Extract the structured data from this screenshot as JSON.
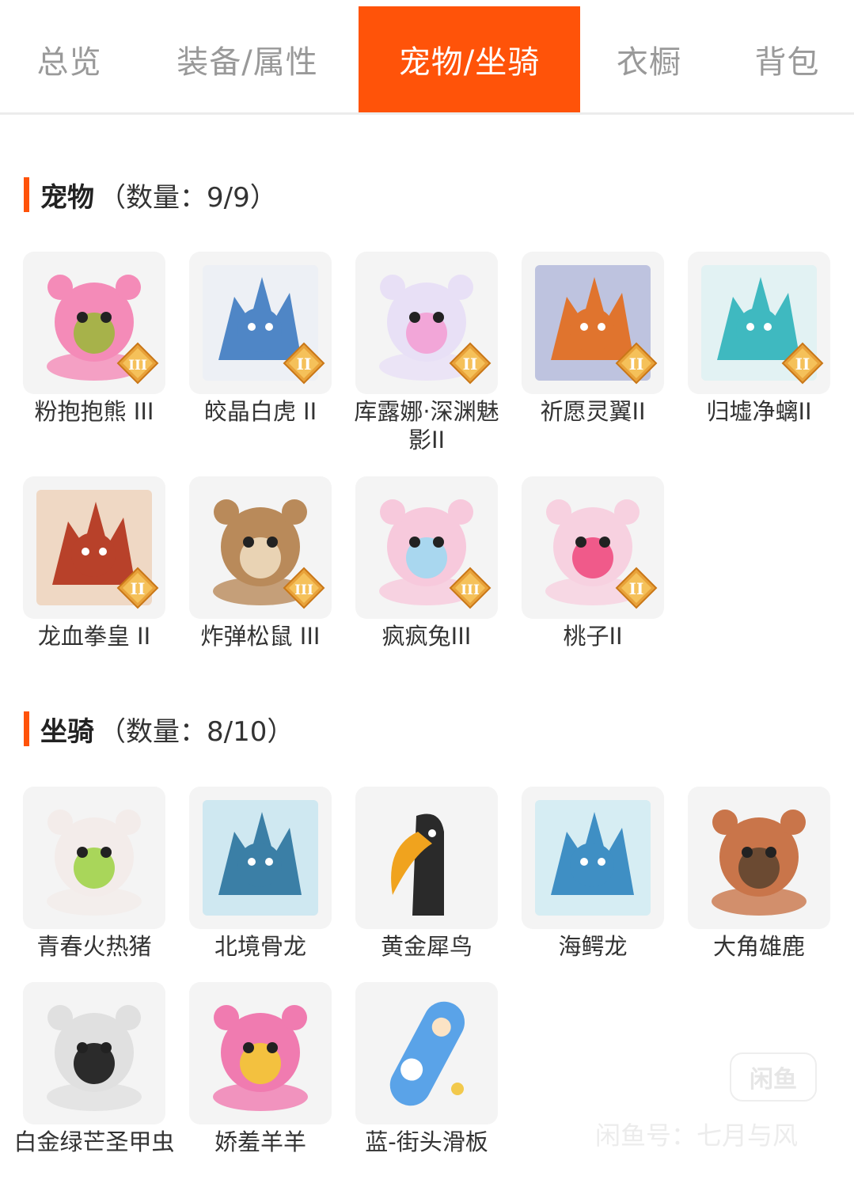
{
  "tabs": [
    "总览",
    "装备/属性",
    "宠物/坐骑",
    "衣橱",
    "背包"
  ],
  "active_tab": "宠物/坐骑",
  "colors": {
    "accent": "#ff5309",
    "tab_inactive": "#999999",
    "card_bg": "#f4f4f4"
  },
  "pets": {
    "title": "宠物",
    "count": "（数量：9/9）",
    "items": [
      {
        "label": "粉抱抱熊 III",
        "icon": "pink-bear-icon",
        "rank": "III"
      },
      {
        "label": "皎晶白虎 II",
        "icon": "white-tiger-icon",
        "rank": "II"
      },
      {
        "label": "库露娜·深渊魅影II",
        "icon": "abyss-fairy-icon",
        "rank": "II"
      },
      {
        "label": "祈愿灵翼II",
        "icon": "spirit-bird-icon",
        "rank": "II"
      },
      {
        "label": "归墟净螭II",
        "icon": "cyan-dragon-icon",
        "rank": "II"
      },
      {
        "label": "龙血拳皇 II",
        "icon": "red-ram-beast-icon",
        "rank": "II"
      },
      {
        "label": "炸弹松鼠 III",
        "icon": "squirrel-icon",
        "rank": "III"
      },
      {
        "label": "疯疯兔III",
        "icon": "bunny-icon",
        "rank": "III"
      },
      {
        "label": "桃子II",
        "icon": "pink-cat-icon",
        "rank": "II"
      }
    ]
  },
  "mounts": {
    "title": "坐骑",
    "count": "（数量：8/10）",
    "items": [
      {
        "label": "青春火热猪",
        "icon": "pig-icon"
      },
      {
        "label": "北境骨龙",
        "icon": "bone-dragon-icon"
      },
      {
        "label": "黄金犀鸟",
        "icon": "hornbill-icon"
      },
      {
        "label": "海鳄龙",
        "icon": "sea-dragon-icon"
      },
      {
        "label": "大角雄鹿",
        "icon": "deer-icon"
      },
      {
        "label": "白金绿芒圣甲虫",
        "icon": "beetle-icon"
      },
      {
        "label": "娇羞羊羊",
        "icon": "pink-sheep-icon"
      },
      {
        "label": "蓝-街头滑板",
        "icon": "skateboard-icon"
      }
    ]
  },
  "watermark": {
    "logo": "闲鱼",
    "text": "闲鱼号：七月与风"
  }
}
